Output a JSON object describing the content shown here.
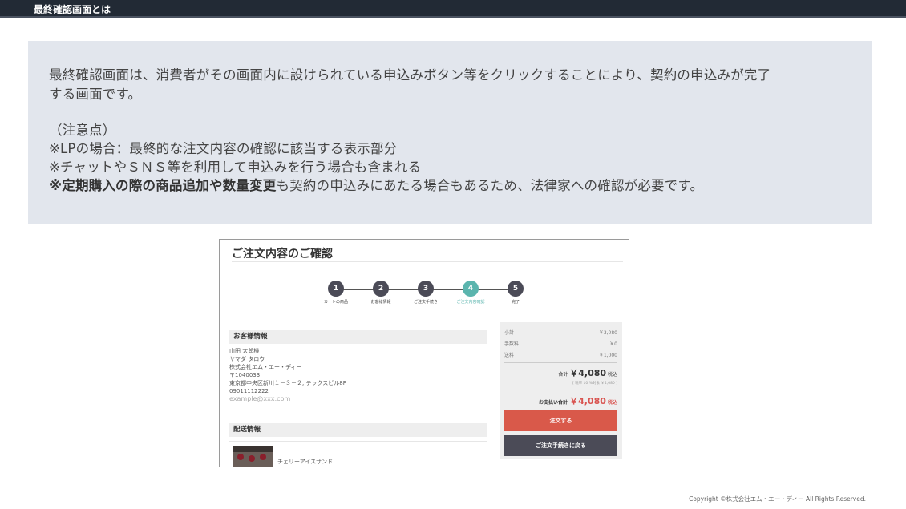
{
  "header": {
    "title": "最終確認画面とは"
  },
  "info": {
    "line1": "最終確認画面は、消費者がその画面内に設けられている申込みボタン等をクリックすることにより、契約の申込みが完了",
    "line2": "する画面です。",
    "note_title": "（注意点）",
    "note1": "※LPの場合：最終的な注文内容の確認に該当する表示部分",
    "note2": "※チャットやＳＮＳ等を利用して申込みを行う場合も含まれる",
    "note3_bold": "※定期購入の際の商品追加や数量変更",
    "note3_rest": "も契約の申込みにあたる場合もあるため、法律家への確認が必要です。"
  },
  "screenshot": {
    "title": "ご注文内容のご確認",
    "steps": [
      {
        "num": "1",
        "label": "カートの商品"
      },
      {
        "num": "2",
        "label": "お客様情報"
      },
      {
        "num": "3",
        "label": "ご注文手続き"
      },
      {
        "num": "4",
        "label": "ご注文内容確認"
      },
      {
        "num": "5",
        "label": "完了"
      }
    ],
    "active_step": 4,
    "customer": {
      "heading": "お客様情報",
      "name": "山田 太郎様",
      "kana": "ヤマダ タロウ",
      "company": "株式会社エム・エー・ディー",
      "zip": "〒1040033",
      "address": "東京都中央区新川１－３－２, テックスビル8F",
      "phone": "09011112222",
      "email": "example@xxx.com"
    },
    "shipping": {
      "heading": "配送情報",
      "product": "チェリーアイスサンド"
    },
    "summary": {
      "subtotal_label": "小計",
      "subtotal": "￥3,080",
      "fee_label": "手数料",
      "fee": "￥0",
      "shipping_label": "送料",
      "shipping": "￥1,000",
      "total_label": "合計",
      "total": "￥4,080",
      "total_suffix": "税込",
      "tax_note": "[ 税率 10 %対象 ￥4,080 ]",
      "pay_label": "お支払い合計",
      "pay_total": "￥4,080",
      "pay_suffix": "税込",
      "order_button": "注文する",
      "back_button": "ご注文手続きに戻る"
    }
  },
  "footer": {
    "copyright": "Copyright ©株式会社エム・エー・ディー All Rights Reserved."
  },
  "colors": {
    "topbar": "#222a35",
    "infobox": "#e2e6ed",
    "step_active": "#5bb5ae",
    "order_button": "#d9594a",
    "back_button": "#4b4b57"
  }
}
